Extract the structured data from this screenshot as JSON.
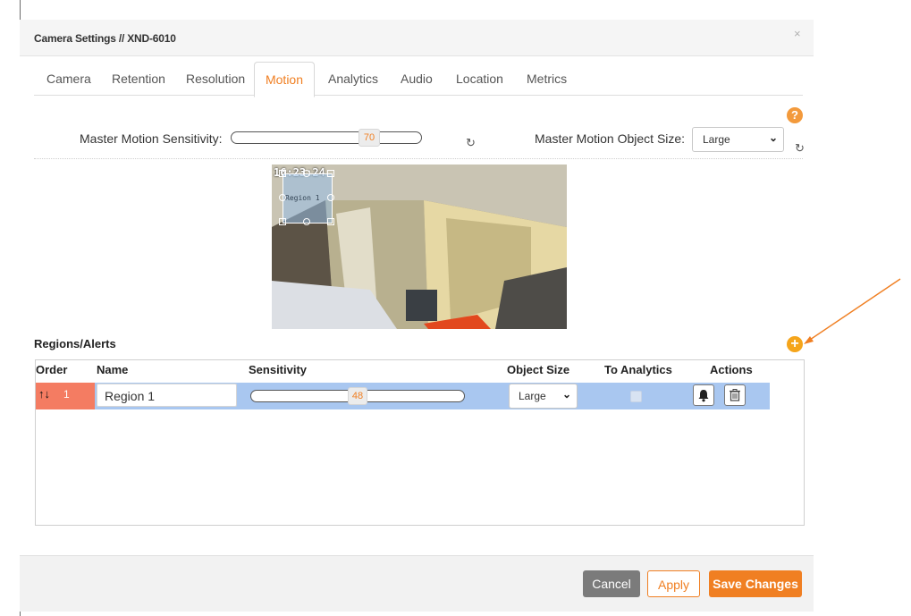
{
  "dialog": {
    "title": "Camera Settings // XND-6010",
    "close_label": "×"
  },
  "tabs": [
    {
      "label": "Camera"
    },
    {
      "label": "Retention"
    },
    {
      "label": "Resolution"
    },
    {
      "label": "Motion"
    },
    {
      "label": "Analytics"
    },
    {
      "label": "Audio"
    },
    {
      "label": "Location"
    },
    {
      "label": "Metrics"
    }
  ],
  "active_tab": "Motion",
  "help_label": "?",
  "master": {
    "sensitivity_label": "Master Motion Sensitivity:",
    "sensitivity_value": "70",
    "object_size_label": "Master Motion Object Size:",
    "object_size_value": "Large",
    "reset_glyph": "↻"
  },
  "camera_preview": {
    "timestamp": "16:23:24",
    "region_overlay_label": "Region 1"
  },
  "regions": {
    "title": "Regions/Alerts",
    "add_label": "+",
    "columns": [
      "Order",
      "Name",
      "Sensitivity",
      "Object Size",
      "To Analytics",
      "Actions"
    ],
    "rows": [
      {
        "order_arrows": "↑↓",
        "order": "1",
        "name": "Region 1",
        "sensitivity": "48",
        "object_size": "Large",
        "to_analytics": false
      }
    ]
  },
  "footer": {
    "cancel": "Cancel",
    "apply": "Apply",
    "save": "Save Changes"
  },
  "colors": {
    "accent": "#f07f22",
    "row_highlight": "#a9c7f0",
    "order_cell": "#f47c62"
  }
}
